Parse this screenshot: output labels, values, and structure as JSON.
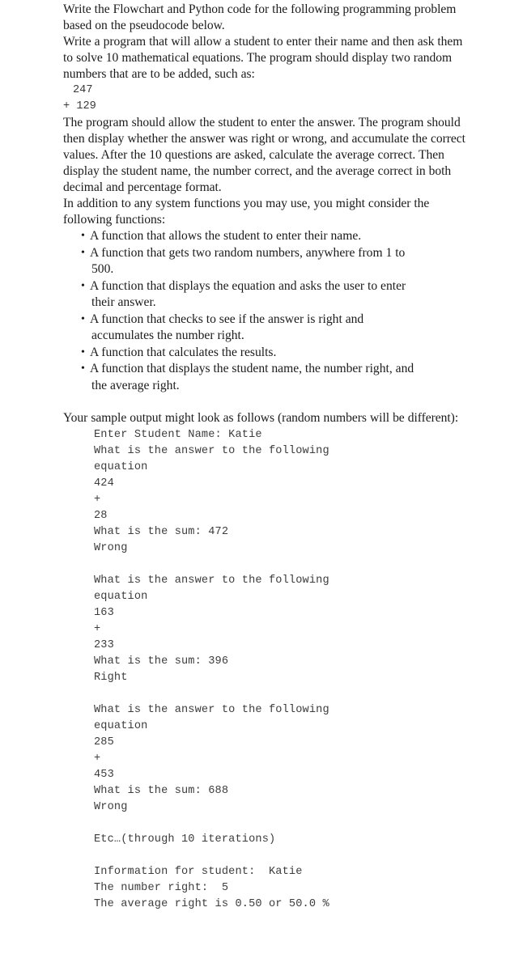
{
  "document": {
    "intro_paragraphs": [
      "Write the Flowchart and Python code for the following programming problem based on the pseudocode below.",
      "Write a program that will allow a student to enter their name and then ask them to solve 10 mathematical equations.  The program should display two random numbers that are to be added, such as:"
    ],
    "inline_example": {
      "top_operand": "247",
      "bottom_line": "+ 129"
    },
    "body_paragraphs": [
      "The program should allow the student to enter the answer.  The program should then display whether the answer was right or wrong, and accumulate the correct values.  After the 10 questions are asked, calculate the average correct.  Then display the student name, the number correct, and the average correct in both decimal and percentage format.",
      "In addition to any system functions you may use, you might consider the following functions:"
    ],
    "bullet_symbol": "•",
    "function_bullets": [
      {
        "line1": "A function that allows the student to enter their name.",
        "line2": ""
      },
      {
        "line1": "A function that gets two random numbers, anywhere from 1 to",
        "line2": "500."
      },
      {
        "line1": "A function that displays the equation and asks the user to enter",
        "line2": "their answer."
      },
      {
        "line1": "A function that checks to see if the answer is right and",
        "line2": "accumulates the number right."
      },
      {
        "line1": "A function that calculates the results.",
        "line2": ""
      },
      {
        "line1": "A function that displays the student name, the number right, and",
        "line2": "the average right."
      }
    ],
    "sample_intro": "Your sample output might look as follows (random numbers will be different):",
    "sample_output_lines": [
      "Enter Student Name: Katie",
      "What is the answer to the following",
      "equation",
      "424",
      "+",
      "28",
      "What is the sum: 472",
      "Wrong",
      "",
      "What is the answer to the following",
      "equation",
      "163",
      "+",
      "233",
      "What is the sum: 396",
      "Right",
      "",
      "What is the answer to the following",
      "equation",
      "285",
      "+",
      "453",
      "What is the sum: 688",
      "Wrong",
      "",
      "Etc…(through 10 iterations)",
      "",
      "Information for student:  Katie",
      "The number right:  5",
      "The average right is 0.50 or 50.0 %"
    ]
  }
}
